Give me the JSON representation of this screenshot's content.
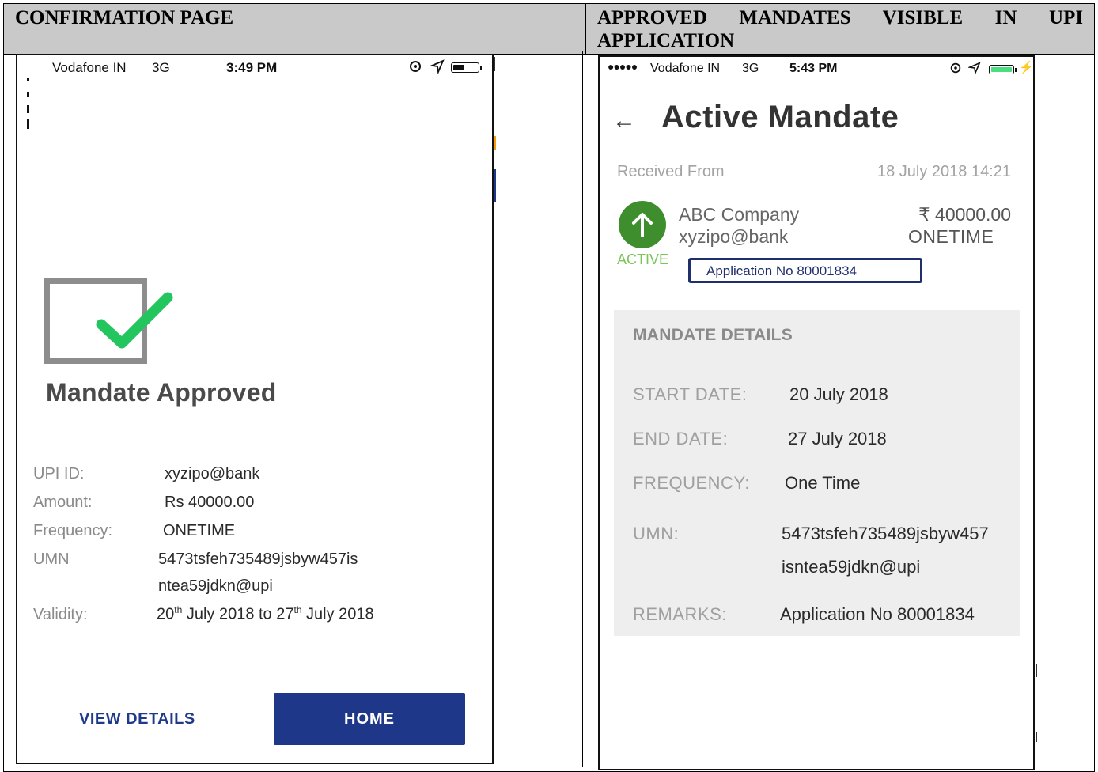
{
  "headers": {
    "left": "CONFIRMATION PAGE",
    "right": "APPROVED MANDATES VISIBLE IN UPI APPLICATION"
  },
  "left_phone": {
    "status": {
      "carrier": "Vodafone IN",
      "network": "3G",
      "time": "3:49 PM",
      "battery_level": 0.4
    },
    "title": "Mandate Approved",
    "fields": {
      "upi_label": "UPI ID:",
      "upi_value": "xyzipo@bank",
      "amount_label": "Amount:",
      "amount_value": "Rs 40000.00",
      "frequency_label": "Frequency:",
      "frequency_value": "ONETIME",
      "umn_label": "UMN",
      "umn_line1": "5473tsfeh735489jsbyw457is",
      "umn_line2": "ntea59jdkn@upi",
      "validity_label": "Validity:",
      "validity_from_day": "20",
      "validity_from_sup": "th",
      "validity_from_rest": " July 2018 to ",
      "validity_to_day": "27",
      "validity_to_sup": "th",
      "validity_to_rest": " July 2018"
    },
    "buttons": {
      "view_details": "VIEW DETAILS",
      "home": "HOME"
    },
    "colors": {
      "check": "#22c55e",
      "button": "#1f3789"
    }
  },
  "right_phone": {
    "status": {
      "carrier": "Vodafone IN",
      "network": "3G",
      "time": "5:43 PM",
      "battery_level": 1.0
    },
    "title": "Active Mandate",
    "received_label": "Received From",
    "received_time": "18 July 2018 14:21",
    "payee": {
      "name": "ABC Company",
      "vpa": "xyzipo@bank",
      "amount": "₹ 40000.00",
      "frequency": "ONETIME",
      "status": "ACTIVE"
    },
    "application_box": "Application No 80001834",
    "details": {
      "heading": "MANDATE DETAILS",
      "start_label": "START DATE:",
      "start_value": "20 July 2018",
      "end_label": "END DATE:",
      "end_value": "27 July 2018",
      "freq_label": "FREQUENCY:",
      "freq_value": "One Time",
      "umn_label": "UMN:",
      "umn_line1": "5473tsfeh735489jsbyw457",
      "umn_line2": "isntea59jdkn@upi",
      "remarks_label": "REMARKS:",
      "remarks_value": "Application No 80001834"
    },
    "colors": {
      "active": "#3e8e2e",
      "battery": "#4ade80"
    }
  }
}
